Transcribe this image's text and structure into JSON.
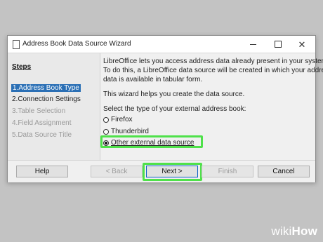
{
  "window": {
    "title": "Address Book Data Source Wizard",
    "minimize_icon": "minimize-icon",
    "maximize_icon": "maximize-icon",
    "close_icon": "close-icon"
  },
  "steps": {
    "heading": "Steps",
    "items": [
      {
        "label": "1.Address Book Type",
        "state": "active"
      },
      {
        "label": "2.Connection Settings",
        "state": "normal"
      },
      {
        "label": "3.Table Selection",
        "state": "disabled"
      },
      {
        "label": "4.Field Assignment",
        "state": "disabled"
      },
      {
        "label": "5.Data Source Title",
        "state": "disabled"
      }
    ]
  },
  "content": {
    "intro_line1": "LibreOffice lets you access address data already present in your system.",
    "intro_line2": "To do this, a LibreOffice data source will be created in which your address",
    "intro_line3": "data is available in tabular form.",
    "helper": "This wizard helps you create the data source.",
    "select_prompt": "Select the type of your external address book:",
    "options": [
      {
        "label": "Firefox",
        "checked": false
      },
      {
        "label": "Thunderbird",
        "checked": false
      },
      {
        "label": "Other external data source",
        "checked": true
      }
    ]
  },
  "buttons": {
    "help": "Help",
    "back": "< Back",
    "next": "Next >",
    "finish": "Finish",
    "cancel": "Cancel"
  },
  "highlight_color": "#4fe14a",
  "watermark": {
    "prefix": "wiki",
    "suffix": "How"
  }
}
